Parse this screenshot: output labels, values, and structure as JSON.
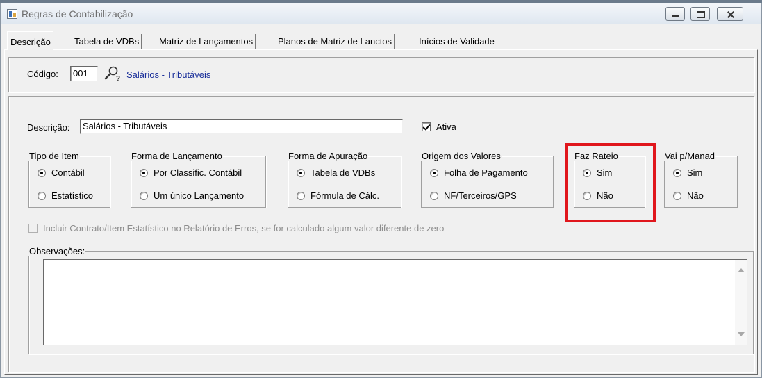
{
  "window": {
    "title": "Regras de Contabilização"
  },
  "tabs": [
    {
      "label": "Descrição",
      "active": true
    },
    {
      "label": "Tabela de VDBs"
    },
    {
      "label": "Matriz de Lançamentos"
    },
    {
      "label": "Planos de Matriz de Lanctos"
    },
    {
      "label": "Inícios de Validade"
    }
  ],
  "header": {
    "codigo_label": "Código:",
    "codigo_value": "001",
    "codigo_description": "Salários - Tributáveis"
  },
  "form": {
    "descricao_label": "Descrição:",
    "descricao_value": "Salários - Tributáveis",
    "ativa_label": "Ativa",
    "ativa_checked": true,
    "groups": {
      "tipo_item": {
        "title": "Tipo de Item",
        "options": [
          "Contábil",
          "Estatístico"
        ],
        "selected": "Contábil"
      },
      "forma_lancamento": {
        "title": "Forma de Lançamento",
        "options": [
          "Por Classific. Contábil",
          "Um único Lançamento"
        ],
        "selected": "Por Classific. Contábil"
      },
      "forma_apuracao": {
        "title": "Forma de Apuração",
        "options": [
          "Tabela de VDBs",
          "Fórmula de Cálc."
        ],
        "selected": "Tabela de VDBs"
      },
      "origem_valores": {
        "title": "Origem dos Valores",
        "options": [
          "Folha de Pagamento",
          "NF/Terceiros/GPS"
        ],
        "selected": "Folha de Pagamento"
      },
      "faz_rateio": {
        "title": "Faz Rateio",
        "options": [
          "Sim",
          "Não"
        ],
        "selected": "Sim"
      },
      "vai_manad": {
        "title": "Vai p/Manad",
        "options": [
          "Sim",
          "Não"
        ],
        "selected": "Sim"
      }
    },
    "incluir_contrato_label": "Incluir Contrato/Item Estatístico no Relatório de Erros, se for calculado algum valor diferente de zero",
    "observacoes_label": "Observações:",
    "observacoes_value": ""
  },
  "colors": {
    "highlight": "#e0161c",
    "link_text": "#1a2f9a",
    "window_bg": "#f0f0f0"
  }
}
